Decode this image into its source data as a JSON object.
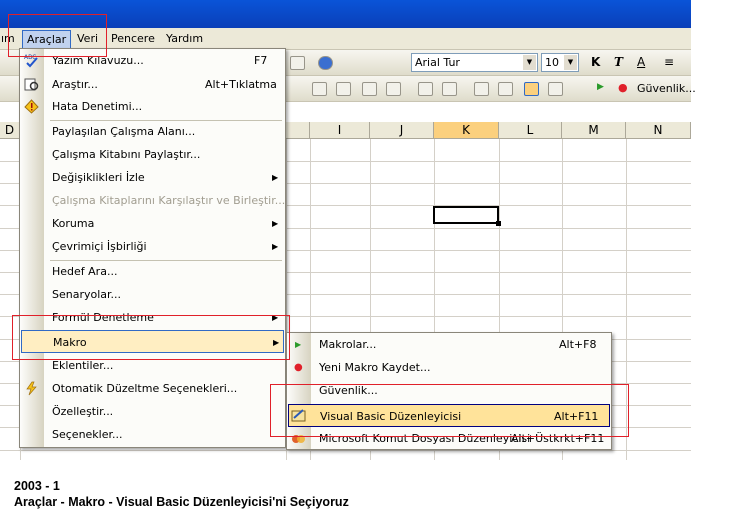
{
  "menubar": {
    "items": [
      {
        "label": "ım"
      },
      {
        "label": "Araçlar"
      },
      {
        "label": "Veri"
      },
      {
        "label": "Pencere"
      },
      {
        "label": "Yardım"
      }
    ]
  },
  "toolbar": {
    "font_name": "Arial Tur",
    "font_size": "10",
    "bold_label": "K",
    "italic_label": "T",
    "underline_label": "A",
    "security_label": "Güvenlik..."
  },
  "sheet": {
    "columns": [
      "D",
      "I",
      "J",
      "K",
      "L",
      "M",
      "N"
    ],
    "selected_column": "K"
  },
  "tools_menu": {
    "items": [
      {
        "label": "Yazım Kılavuzu...",
        "shortcut": "F7"
      },
      {
        "label": "Araştır...",
        "shortcut": "Alt+Tıklatma"
      },
      {
        "label": "Hata Denetimi..."
      },
      {
        "label": "Paylaşılan Çalışma Alanı..."
      },
      {
        "label": "Çalışma Kitabını Paylaştır..."
      },
      {
        "label": "Değişiklikleri İzle"
      },
      {
        "label": "Çalışma Kitaplarını Karşılaştır ve Birleştir..."
      },
      {
        "label": "Koruma"
      },
      {
        "label": "Çevrimiçi İşbirliği"
      },
      {
        "label": "Hedef Ara..."
      },
      {
        "label": "Senaryolar..."
      },
      {
        "label": "Formül Denetleme"
      },
      {
        "label": "Makro"
      },
      {
        "label": "Eklentiler..."
      },
      {
        "label": "Otomatik Düzeltme Seçenekleri..."
      },
      {
        "label": "Özelleştir..."
      },
      {
        "label": "Seçenekler..."
      }
    ]
  },
  "macro_submenu": {
    "items": [
      {
        "label": "Makrolar...",
        "shortcut": "Alt+F8"
      },
      {
        "label": "Yeni Makro Kaydet..."
      },
      {
        "label": "Güvenlik..."
      },
      {
        "label": "Visual Basic Düzenleyicisi",
        "shortcut": "Alt+F11"
      },
      {
        "label": "Microsoft Komut Dosyası Düzenleyicisi",
        "shortcut": "Alt+Üstkrkt+F11"
      }
    ]
  },
  "caption": {
    "line1": "2003 - 1",
    "line2": "Araçlar - Makro - Visual Basic Düzenleyicisi'ni Seçiyoruz"
  },
  "colors": {
    "titlebar": "#0a54d8",
    "highlight": "#ffeec2",
    "annotation_red": "#e0202a",
    "selected_column": "#fbd07e"
  }
}
